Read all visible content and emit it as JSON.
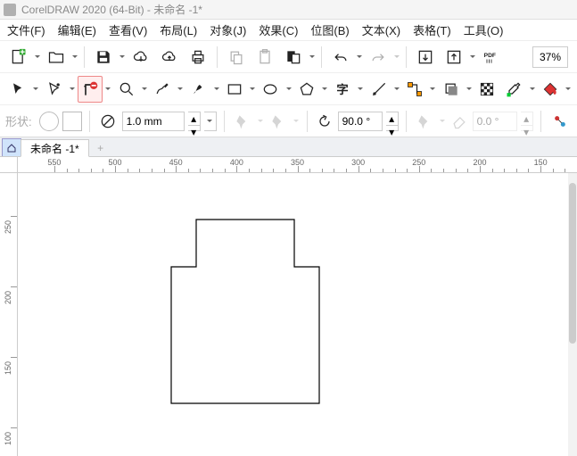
{
  "window": {
    "title": "CorelDRAW 2020 (64-Bit) - 未命名 -1*"
  },
  "menu": {
    "file": "文件(F)",
    "edit": "编辑(E)",
    "view": "查看(V)",
    "layout": "布局(L)",
    "object": "对象(J)",
    "effects": "效果(C)",
    "bitmap": "位图(B)",
    "text": "文本(X)",
    "table": "表格(T)",
    "tools": "工具(O)"
  },
  "zoom": {
    "value": "37%"
  },
  "props": {
    "shape_label": "形状:",
    "outline_width": "1.0 mm",
    "angle1": "90.0 °",
    "angle2": "0.0 °"
  },
  "tabs": {
    "doc1": "未命名 -1*",
    "add": "+"
  },
  "hruler_ticks": [
    550,
    500,
    450,
    400,
    350,
    300,
    250,
    200,
    150
  ],
  "vruler_ticks": [
    250,
    200,
    150,
    100
  ]
}
